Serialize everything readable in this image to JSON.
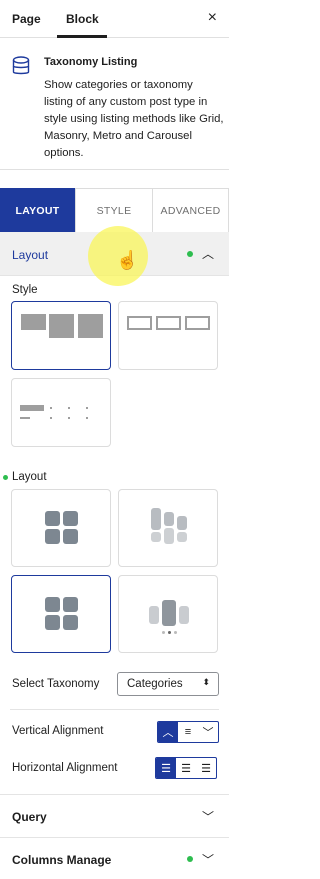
{
  "tabs": {
    "page": "Page",
    "block": "Block",
    "close": "×"
  },
  "block": {
    "title": "Taxonomy Listing",
    "description": "Show categories or taxonomy listing of any custom post type in style using listing methods like Grid, Masonry, Metro and Carousel options."
  },
  "panel_tabs": {
    "layout": "LAYOUT",
    "style": "STYLE",
    "advanced": "ADVANCED"
  },
  "layout_section": {
    "title": "Layout",
    "style_label": "Style",
    "layout_label": "Layout",
    "select_taxonomy_label": "Select Taxonomy",
    "select_taxonomy_value": "Categories",
    "vertical_alignment_label": "Vertical Alignment",
    "horizontal_alignment_label": "Horizontal Alignment"
  },
  "collapsed_sections": {
    "query": "Query",
    "columns": "Columns Manage"
  },
  "colors": {
    "accent": "#1e3a9d",
    "status_green": "#2ebd4f"
  }
}
